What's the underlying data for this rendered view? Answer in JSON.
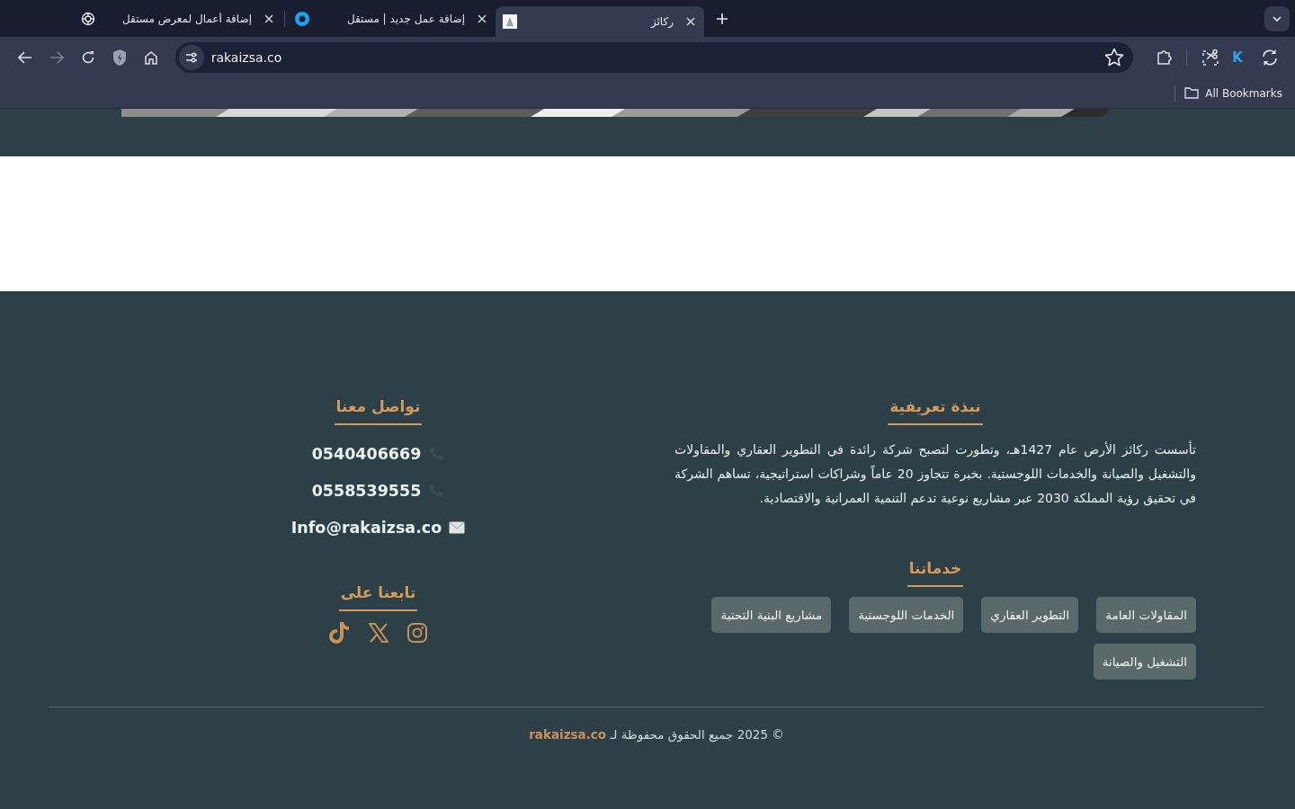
{
  "browser": {
    "tabs": [
      {
        "title": "ركائز",
        "kind": "page",
        "selected": true
      },
      {
        "title": "إضافة عمل جديد | مستقل",
        "kind": "ring",
        "selected": false
      },
      {
        "title": "إضافة أعمال لمعرض مستقل",
        "kind": "knot",
        "selected": false
      }
    ],
    "forward_disabled": true,
    "address": "rakaizsa.co",
    "extension_letter": "K",
    "bookmarks_label": "All Bookmarks"
  },
  "page": {
    "about": {
      "heading": "نبذة تعريفية",
      "text": "تأسست ركائز الأرض عام 1427هـ، وتطورت لتصبح شركة رائدة في التطوير العقاري والمقاولات والتشغيل والصيانة والخدمات اللوجستية. بخبرة تتجاوز 20 عاماً وشراكات استراتيجية، تساهم الشركة في تحقيق رؤية المملكة 2030 عبر مشاريع نوعية تدعم التنمية العمرانية والاقتصادية."
    },
    "services": {
      "heading": "خدماتنا",
      "items": [
        "المقاولات العامة",
        "التطوير العقاري",
        "الخدمات اللوجستية",
        "مشاريع البنية التحتية",
        "التشغيل والصيانة"
      ]
    },
    "contact": {
      "heading": "تواصل معنا",
      "items": [
        {
          "kind": "phone",
          "text": "0540406669"
        },
        {
          "kind": "phone",
          "text": "0558539555"
        },
        {
          "kind": "email",
          "text": "Info@rakaizsa.co"
        }
      ]
    },
    "follow": {
      "heading": "تابعنا على",
      "socials": [
        {
          "kind": "instagram"
        },
        {
          "kind": "x"
        },
        {
          "kind": "tiktok"
        }
      ]
    },
    "copyright": "© 2025 جميع الحقوق محفوظة لـ **rakaizsa.co**"
  }
}
